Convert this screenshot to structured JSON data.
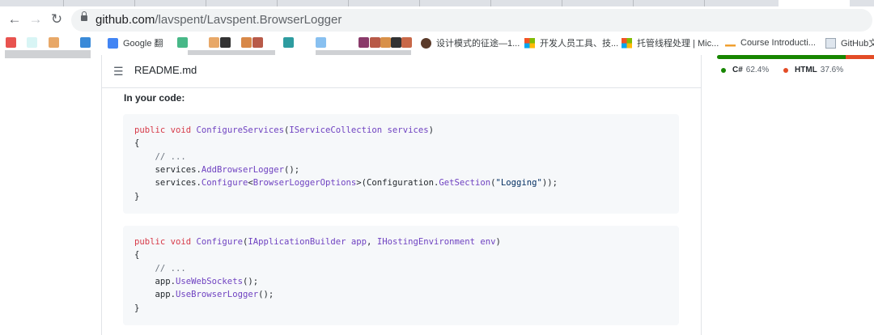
{
  "browser": {
    "url_host": "github.com",
    "url_path": "/lavspent/Lavspent.BrowserLogger",
    "back_glyph": "←",
    "forward_glyph": "→",
    "reload_glyph": "↻"
  },
  "bookmarks": {
    "items": [
      {
        "label": "Google 翻",
        "icon": "google-translate-icon"
      },
      {
        "label": "设计模式的征途—1...",
        "icon": "avatar-icon"
      },
      {
        "label": "开发人员工具、技...",
        "icon": "microsoft-icon"
      },
      {
        "label": "托管线程处理 | Mic...",
        "icon": "microsoft-icon"
      },
      {
        "label": "Course Introducti...",
        "icon": "course-icon"
      },
      {
        "label": "GitHub文",
        "icon": "document-icon"
      }
    ],
    "colors": [
      "#e8534f",
      "#d8f5f5",
      "#e8a868",
      "#3a8ad8",
      "#48b888",
      "#e8a868",
      "#333333",
      "#d88848",
      "#2e9ca0",
      "#88c0f0",
      "#8a3a6a",
      "#b85a48",
      "#d89048",
      "#333333",
      "#c86848"
    ]
  },
  "readme": {
    "list_glyph": "☰",
    "title": "README.md",
    "section_label": "In your code:",
    "block1": {
      "l1_kw": "public void ",
      "l1_fn": "ConfigureServices",
      "l1_p1": "(",
      "l1_type": "IServiceCollection services",
      "l1_p2": ")",
      "l2": "{",
      "l3": "    // ...",
      "l4_a": "    services.",
      "l4_fn": "AddBrowserLogger",
      "l4_b": "();",
      "l5_a": "    services.",
      "l5_fn": "Configure",
      "l5_b": "<",
      "l5_type": "BrowserLoggerOptions",
      "l5_c": ">(Configuration.",
      "l5_fn2": "GetSection",
      "l5_d": "(",
      "l5_str": "\"Logging\"",
      "l5_e": "));",
      "l6": "}"
    },
    "block2": {
      "l1_kw": "public void ",
      "l1_fn": "Configure",
      "l1_p1": "(",
      "l1_type": "IApplicationBuilder app",
      "l1_comma": ", ",
      "l1_type2": "IHostingEnvironment env",
      "l1_p2": ")",
      "l2": "{",
      "l3": "    // ...",
      "l4_a": "    app.",
      "l4_fn": "UseWebSockets",
      "l4_b": "();",
      "l5_a": "    app.",
      "l5_fn": "UseBrowserLogger",
      "l5_b": "();",
      "l6": "}"
    }
  },
  "languages": {
    "items": [
      {
        "name": "C#",
        "percent": "62.4%",
        "value": 62.4,
        "color": "#178600"
      },
      {
        "name": "HTML",
        "percent": "37.6%",
        "value": 37.6,
        "color": "#e34c26"
      }
    ]
  }
}
